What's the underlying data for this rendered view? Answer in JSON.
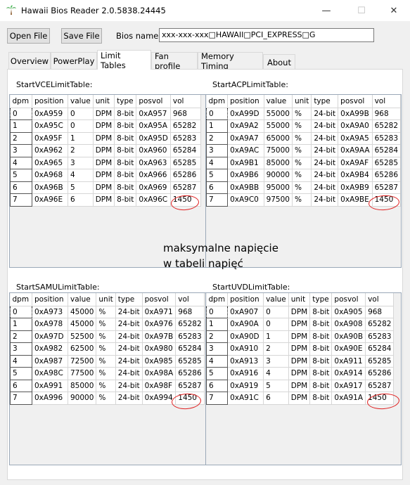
{
  "window": {
    "title": "Hawaii Bios Reader 2.0.5838.24445",
    "minimize_glyph": "—",
    "maximize_glyph": "☐",
    "close_glyph": "✕"
  },
  "toolbar": {
    "open_label": "Open File",
    "save_label": "Save File",
    "bios_name_label": "Bios name:",
    "bios_name_value": "xxx-xxx-xxx□HAWAII□PCI_EXPRESS□G"
  },
  "tabs": [
    {
      "label": "Overview"
    },
    {
      "label": "PowerPlay"
    },
    {
      "label": "Limit Tables"
    },
    {
      "label": "Fan profile"
    },
    {
      "label": "Memory Timing"
    },
    {
      "label": "About"
    }
  ],
  "vce": {
    "label": "StartVCELimitTable:",
    "headers": [
      "dpm",
      "position",
      "value",
      "unit",
      "type",
      "posvol",
      "vol"
    ],
    "rows": [
      [
        "0",
        "0xA959",
        "0",
        "DPM",
        "8-bit",
        "0xA957",
        "968"
      ],
      [
        "1",
        "0xA95C",
        "0",
        "DPM",
        "8-bit",
        "0xA95A",
        "65282"
      ],
      [
        "2",
        "0xA95F",
        "1",
        "DPM",
        "8-bit",
        "0xA95D",
        "65283"
      ],
      [
        "3",
        "0xA962",
        "2",
        "DPM",
        "8-bit",
        "0xA960",
        "65284"
      ],
      [
        "4",
        "0xA965",
        "3",
        "DPM",
        "8-bit",
        "0xA963",
        "65285"
      ],
      [
        "5",
        "0xA968",
        "4",
        "DPM",
        "8-bit",
        "0xA966",
        "65286"
      ],
      [
        "6",
        "0xA96B",
        "5",
        "DPM",
        "8-bit",
        "0xA969",
        "65287"
      ],
      [
        "7",
        "0xA96E",
        "6",
        "DPM",
        "8-bit",
        "0xA96C",
        "1450"
      ]
    ]
  },
  "acp": {
    "label": "StartACPLimitTable:",
    "headers": [
      "dpm",
      "position",
      "value",
      "unit",
      "type",
      "posvol",
      "vol"
    ],
    "rows": [
      [
        "0",
        "0xA99D",
        "55000",
        "%",
        "24-bit",
        "0xA99B",
        "968"
      ],
      [
        "1",
        "0xA9A2",
        "55000",
        "%",
        "24-bit",
        "0xA9A0",
        "65282"
      ],
      [
        "2",
        "0xA9A7",
        "65000",
        "%",
        "24-bit",
        "0xA9A5",
        "65283"
      ],
      [
        "3",
        "0xA9AC",
        "75000",
        "%",
        "24-bit",
        "0xA9AA",
        "65284"
      ],
      [
        "4",
        "0xA9B1",
        "85000",
        "%",
        "24-bit",
        "0xA9AF",
        "65285"
      ],
      [
        "5",
        "0xA9B6",
        "90000",
        "%",
        "24-bit",
        "0xA9B4",
        "65286"
      ],
      [
        "6",
        "0xA9BB",
        "95000",
        "%",
        "24-bit",
        "0xA9B9",
        "65287"
      ],
      [
        "7",
        "0xA9C0",
        "97500",
        "%",
        "24-bit",
        "0xA9BE",
        "1450"
      ]
    ]
  },
  "samu": {
    "label": "StartSAMULimitTable:",
    "headers": [
      "dpm",
      "position",
      "value",
      "unit",
      "type",
      "posvol",
      "vol"
    ],
    "rows": [
      [
        "0",
        "0xA973",
        "45000",
        "%",
        "24-bit",
        "0xA971",
        "968"
      ],
      [
        "1",
        "0xA978",
        "45000",
        "%",
        "24-bit",
        "0xA976",
        "65282"
      ],
      [
        "2",
        "0xA97D",
        "52500",
        "%",
        "24-bit",
        "0xA97B",
        "65283"
      ],
      [
        "3",
        "0xA982",
        "62500",
        "%",
        "24-bit",
        "0xA980",
        "65284"
      ],
      [
        "4",
        "0xA987",
        "72500",
        "%",
        "24-bit",
        "0xA985",
        "65285"
      ],
      [
        "5",
        "0xA98C",
        "77500",
        "%",
        "24-bit",
        "0xA98A",
        "65286"
      ],
      [
        "6",
        "0xA991",
        "85000",
        "%",
        "24-bit",
        "0xA98F",
        "65287"
      ],
      [
        "7",
        "0xA996",
        "90000",
        "%",
        "24-bit",
        "0xA994",
        "1450"
      ]
    ]
  },
  "uvd": {
    "label": "StartUVDLimitTable:",
    "headers": [
      "dpm",
      "position",
      "value",
      "unit",
      "type",
      "posvol",
      "vol"
    ],
    "rows": [
      [
        "0",
        "0xA907",
        "0",
        "DPM",
        "8-bit",
        "0xA905",
        "968"
      ],
      [
        "1",
        "0xA90A",
        "0",
        "DPM",
        "8-bit",
        "0xA908",
        "65282"
      ],
      [
        "2",
        "0xA90D",
        "1",
        "DPM",
        "8-bit",
        "0xA90B",
        "65283"
      ],
      [
        "3",
        "0xA910",
        "2",
        "DPM",
        "8-bit",
        "0xA90E",
        "65284"
      ],
      [
        "4",
        "0xA913",
        "3",
        "DPM",
        "8-bit",
        "0xA911",
        "65285"
      ],
      [
        "5",
        "0xA916",
        "4",
        "DPM",
        "8-bit",
        "0xA914",
        "65286"
      ],
      [
        "6",
        "0xA919",
        "5",
        "DPM",
        "8-bit",
        "0xA917",
        "65287"
      ],
      [
        "7",
        "0xA91C",
        "6",
        "DPM",
        "8-bit",
        "0xA91A",
        "1450"
      ]
    ]
  },
  "annotation": {
    "line1": "maksymalne napięcie",
    "line2": "w tabeli napięć",
    "circle_color": "#e02020"
  }
}
